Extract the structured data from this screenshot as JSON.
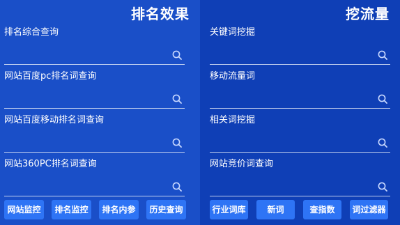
{
  "left": {
    "title": "排名效果",
    "rows": [
      {
        "label": "排名综合查询"
      },
      {
        "label": "网站百度pc排名词查询"
      },
      {
        "label": "网站百度移动排名词查询"
      },
      {
        "label": "网站360PC排名词查询"
      }
    ],
    "buttons": [
      "网站监控",
      "排名监控",
      "排名内参",
      "历史查询"
    ]
  },
  "right": {
    "title": "挖流量",
    "rows": [
      {
        "label": "关键词挖掘"
      },
      {
        "label": "移动流量词"
      },
      {
        "label": "相关词挖掘"
      },
      {
        "label": "网站竞价词查询"
      }
    ],
    "buttons": [
      "行业词库",
      "新词",
      "查指数",
      "词过滤器"
    ]
  },
  "colors": {
    "left_bg": "#1a4fc8",
    "right_bg": "#0f3fb6",
    "button_bg": "#2e74f5",
    "text": "#ffffff"
  },
  "icons": {
    "field_icon": "search-icon"
  }
}
